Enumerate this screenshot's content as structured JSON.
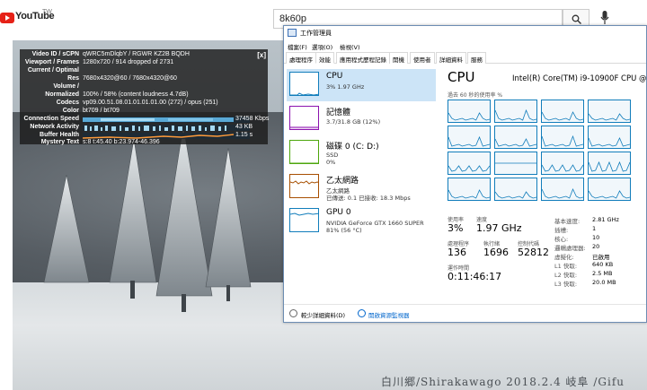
{
  "youtube": {
    "logo": "YouTube",
    "logo_region": "TW",
    "search_value": "8k60p",
    "icons": [
      "menu-icon",
      "search-icon",
      "mic-icon"
    ]
  },
  "video": {
    "caption": "白川郷/Shirakawago 2018.2.4 岐阜 /Gifu"
  },
  "stats": {
    "close": "[x]",
    "rows": [
      {
        "k": "Video ID / sCPN",
        "v": "qWRC5mDlqbY / RGWR KZ2B BQDH"
      },
      {
        "k": "Viewport / Frames",
        "v": "1280x720 / 914 dropped of 2731"
      },
      {
        "k": "Current / Optimal",
        "v": ""
      },
      {
        "k": "Res",
        "v": "7680x4320@60 / 7680x4320@60"
      },
      {
        "k": "Volume /",
        "v": ""
      },
      {
        "k": "Normalized",
        "v": "100% / 58% (content loudness 4.7dB)"
      },
      {
        "k": "Codecs",
        "v": "vp09.00.51.08.01.01.01.01.00 (272) / opus (251)"
      },
      {
        "k": "Color",
        "v": "bt709 / bt709"
      }
    ],
    "connection_label": "Connection Speed",
    "connection_value": "37458 Kbps",
    "network_label": "Network Activity",
    "network_value": "43 KB",
    "buffer_label": "Buffer Health",
    "buffer_value": "1.15 s",
    "mystery_label": "Mystery Text",
    "mystery_value": "s:8 t:45.40 b:23.974-46.396"
  },
  "taskmgr": {
    "title": "工作管理員",
    "menu": [
      "檔案(F)",
      "選項(O)",
      "檢視(V)"
    ],
    "tabs": [
      "處理程序",
      "效能",
      "應用程式歷程記錄",
      "開機",
      "使用者",
      "詳細資料",
      "服務"
    ],
    "active_tab": 1,
    "resources": [
      {
        "title": "CPU",
        "line1": "3% 1.97 GHz",
        "line2": "",
        "color": "#117dbb"
      },
      {
        "title": "記憶體",
        "line1": "3.7/31.8 GB (12%)",
        "line2": "",
        "color": "#8b12ae"
      },
      {
        "title": "磁碟 0 (C: D:)",
        "line1": "SSD",
        "line2": "0%",
        "color": "#4da60c"
      },
      {
        "title": "乙太網路",
        "line1": "乙太網路",
        "line2": "已傳送: 0.1  已接收: 18.3 Mbps",
        "color": "#a74f01"
      },
      {
        "title": "GPU 0",
        "line1": "NVIDIA GeForce GTX 1660 SUPER",
        "line2": "81% (56 °C)",
        "color": "#117dbb"
      }
    ],
    "cpu": {
      "heading": "CPU",
      "model": "Intel(R) Core(TM) i9-10900F CPU @",
      "graph_caption": "過去 60 秒的使用率 %",
      "util_label": "使用率",
      "util_value": "3%",
      "speed_label": "速度",
      "speed_value": "1.97 GHz",
      "proc_label": "處理程序",
      "proc_value": "136",
      "threads_label": "執行緒",
      "threads_value": "1696",
      "handles_label": "控制代碼",
      "handles_value": "52812",
      "uptime_label": "運作時間",
      "uptime_value": "0:11:46:17",
      "details": [
        {
          "k": "基本速度:",
          "v": "2.81 GHz"
        },
        {
          "k": "插槽:",
          "v": "1"
        },
        {
          "k": "核心:",
          "v": "10"
        },
        {
          "k": "邏輯處理器:",
          "v": "20"
        },
        {
          "k": "虛擬化:",
          "v": "已啟用"
        },
        {
          "k": "L1 快取:",
          "v": "640 KB"
        },
        {
          "k": "L2 快取:",
          "v": "2.5 MB"
        },
        {
          "k": "L3 快取:",
          "v": "20.0 MB"
        }
      ]
    },
    "footer": {
      "fewer": "較少詳細資料(D)",
      "monitor": "開啟資源監視器"
    }
  }
}
